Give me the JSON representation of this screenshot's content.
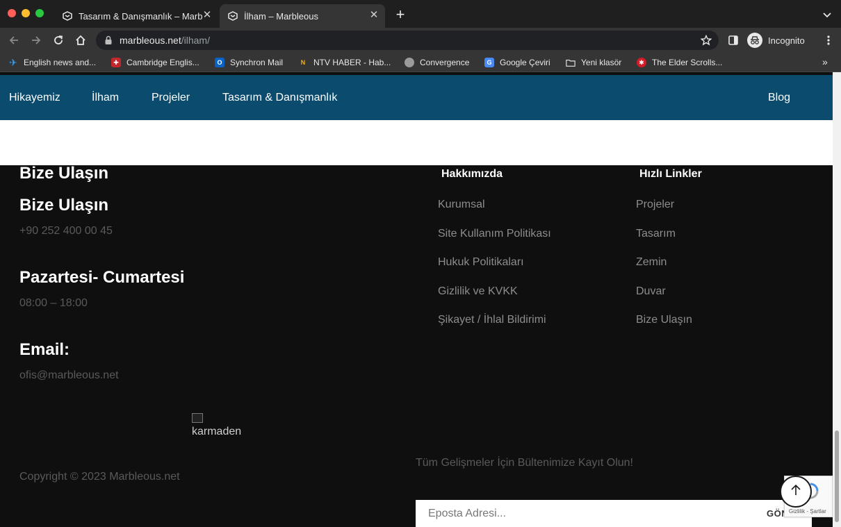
{
  "browser": {
    "tabs": [
      {
        "title": "Tasarım & Danışmanlık – Marbleous",
        "active": false
      },
      {
        "title": "İlham – Marbleous",
        "active": true
      }
    ],
    "url_host": "marbleous.net",
    "url_path": "/ilham/",
    "profile_label": "Incognito",
    "bookmarks": [
      {
        "label": "English news and...",
        "icon": "globe-blue-icon"
      },
      {
        "label": "Cambridge Englis...",
        "icon": "cambridge-icon"
      },
      {
        "label": "Synchron Mail",
        "icon": "outlook-icon"
      },
      {
        "label": "NTV HABER - Hab...",
        "icon": "ntv-icon"
      },
      {
        "label": "Convergence",
        "icon": "globe-icon"
      },
      {
        "label": "Google Çeviri",
        "icon": "google-translate-icon"
      },
      {
        "label": "Yeni klasör",
        "icon": "folder-icon"
      },
      {
        "label": "The Elder Scrolls...",
        "icon": "elder-scrolls-icon"
      }
    ]
  },
  "nav": {
    "items": [
      "Hikayemiz",
      "İlham",
      "Projeler",
      "Tasarım & Danışmanlık"
    ],
    "blog": "Blog"
  },
  "footer": {
    "contact_heading_1": "Bize Ulaşın",
    "contact_heading_2": "Bize Ulaşın",
    "phone": "+90 252 400 00 45",
    "hours_heading": "Pazartesi- Cumartesi",
    "hours": "08:00 – 18:00",
    "email_heading": "Email:",
    "email": "ofis@marbleous.net",
    "broken_image_alt": "karmaden",
    "copyright": "Copyright © 2023 Marbleous.net",
    "about": {
      "title": "Hakkımızda",
      "links": [
        "Kurumsal",
        "Site Kullanım Politikası",
        "Hukuk Politikaları",
        "Gizlilik ve KVKK",
        "Şikayet / İhlal Bildirimi"
      ]
    },
    "quick_links": {
      "title": "Hızlı Linkler",
      "links": [
        "Projeler",
        "Tasarım",
        "Zemin",
        "Duvar",
        "Bize Ulaşın"
      ]
    },
    "newsletter": {
      "prompt": "Tüm Gelişmeler İçin Bültenimize Kayıt Olun!",
      "placeholder": "Eposta Adresi...",
      "submit": "GÖN"
    },
    "recaptcha_text": "Gizlilik - Şartlar"
  },
  "colors": {
    "nav_bg": "#0a4b6e",
    "footer_bg": "#0f0f0f",
    "chrome_bg": "#353535"
  }
}
